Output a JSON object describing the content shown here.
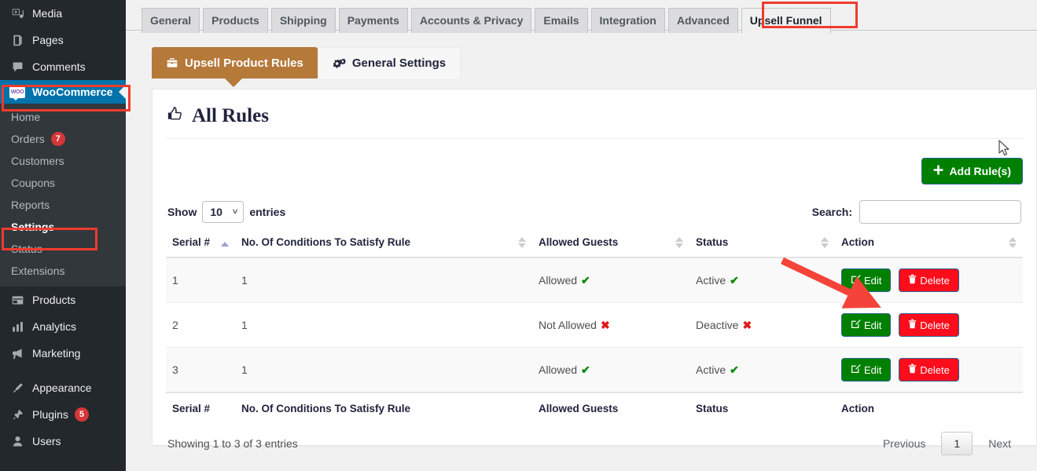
{
  "sidebar": {
    "top_items": [
      {
        "label": "Media",
        "icon": "media-icon"
      },
      {
        "label": "Pages",
        "icon": "pages-icon"
      },
      {
        "label": "Comments",
        "icon": "comments-icon"
      }
    ],
    "woocommerce": {
      "label": "WooCommerce",
      "icon": "woocommerce-icon",
      "badge_text": "WOO"
    },
    "woo_submenu": [
      {
        "label": "Home",
        "count": "",
        "current": false
      },
      {
        "label": "Orders",
        "count": "7",
        "current": false
      },
      {
        "label": "Customers",
        "count": "",
        "current": false
      },
      {
        "label": "Coupons",
        "count": "",
        "current": false
      },
      {
        "label": "Reports",
        "count": "",
        "current": false
      },
      {
        "label": "Settings",
        "count": "",
        "current": true
      },
      {
        "label": "Status",
        "count": "",
        "current": false
      },
      {
        "label": "Extensions",
        "count": "",
        "current": false
      }
    ],
    "bottom_items": [
      {
        "label": "Products",
        "icon": "products-icon",
        "count": ""
      },
      {
        "label": "Analytics",
        "icon": "analytics-icon",
        "count": ""
      },
      {
        "label": "Marketing",
        "icon": "marketing-icon",
        "count": ""
      },
      {
        "label": "Appearance",
        "icon": "appearance-icon",
        "count": ""
      },
      {
        "label": "Plugins",
        "icon": "plugins-icon",
        "count": "5"
      },
      {
        "label": "Users",
        "icon": "users-icon",
        "count": ""
      }
    ]
  },
  "nav_tabs": [
    {
      "label": "General",
      "active": false
    },
    {
      "label": "Products",
      "active": false
    },
    {
      "label": "Shipping",
      "active": false
    },
    {
      "label": "Payments",
      "active": false
    },
    {
      "label": "Accounts & Privacy",
      "active": false
    },
    {
      "label": "Emails",
      "active": false
    },
    {
      "label": "Integration",
      "active": false
    },
    {
      "label": "Advanced",
      "active": false
    },
    {
      "label": "Upsell Funnel",
      "active": true
    }
  ],
  "subtabs": [
    {
      "label": "Upsell Product Rules",
      "icon": "briefcase-icon",
      "active": true
    },
    {
      "label": "General Settings",
      "icon": "gears-icon",
      "active": false
    }
  ],
  "card": {
    "title": "All Rules",
    "title_icon": "thumbs-up-icon",
    "add_button": {
      "label": "Add Rule(s)",
      "icon": "plus-icon"
    }
  },
  "datatable": {
    "length_label_before": "Show",
    "length_value": "10",
    "length_label_after": "entries",
    "search_label": "Search:",
    "search_value": "",
    "search_placeholder": "",
    "columns": [
      {
        "label": "Serial #",
        "sort": "asc"
      },
      {
        "label": "No. Of Conditions To Satisfy Rule",
        "sort": "none"
      },
      {
        "label": "Allowed Guests",
        "sort": "none"
      },
      {
        "label": "Status",
        "sort": "none"
      },
      {
        "label": "Action",
        "sort": "none"
      }
    ],
    "rows": [
      {
        "serial": "1",
        "conditions": "1",
        "guests": "Allowed",
        "guests_mark": "ok",
        "status": "Active",
        "status_mark": "ok",
        "edit_label": "Edit",
        "delete_label": "Delete"
      },
      {
        "serial": "2",
        "conditions": "1",
        "guests": "Not Allowed",
        "guests_mark": "no",
        "status": "Deactive",
        "status_mark": "no",
        "edit_label": "Edit",
        "delete_label": "Delete"
      },
      {
        "serial": "3",
        "conditions": "1",
        "guests": "Allowed",
        "guests_mark": "ok",
        "status": "Active",
        "status_mark": "ok",
        "edit_label": "Edit",
        "delete_label": "Delete"
      }
    ],
    "info": "Showing 1 to 3 of 3 entries",
    "paging": {
      "previous": "Previous",
      "current_page": "1",
      "next": "Next"
    }
  },
  "annotations": {
    "highlight_color": "#ef3b2d",
    "arrow_color": "#f4443a"
  },
  "colors": {
    "sidebar_bg": "#23282d",
    "submenu_bg": "#32373c",
    "woo_active": "#0073aa",
    "subtab_active": "#b5793a",
    "green_button": "#008000",
    "red_button": "#fc0d1b",
    "button_border": "#2a6496",
    "page_bg": "#f1f1f1"
  }
}
